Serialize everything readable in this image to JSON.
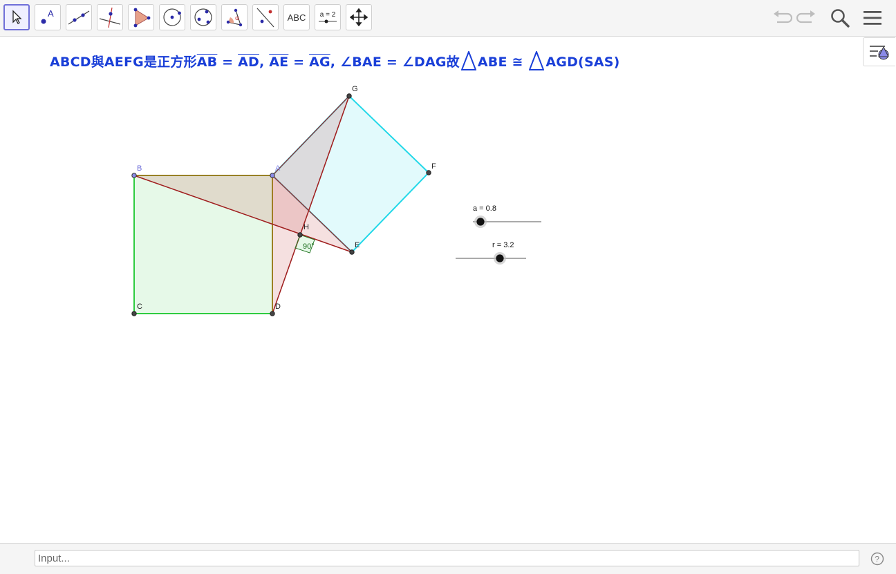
{
  "toolbar": {
    "tools": [
      {
        "name": "move-tool",
        "label": ""
      },
      {
        "name": "point-tool",
        "label": "A"
      },
      {
        "name": "line-tool",
        "label": ""
      },
      {
        "name": "perpendicular-line-tool",
        "label": ""
      },
      {
        "name": "polygon-tool",
        "label": ""
      },
      {
        "name": "circle-tool",
        "label": ""
      },
      {
        "name": "conic-tool",
        "label": ""
      },
      {
        "name": "angle-tool",
        "label": "α"
      },
      {
        "name": "reflect-tool",
        "label": ""
      },
      {
        "name": "text-tool",
        "label": "ABC"
      },
      {
        "name": "slider-tool",
        "label": "a = 2"
      },
      {
        "name": "move-graphics-view-tool",
        "label": ""
      }
    ]
  },
  "formula": {
    "intro": "ABCD與AEFG是正方形",
    "seg1": "AB",
    "eq1": " = ",
    "seg2": "AD",
    "comma1": ", ",
    "seg3": "AE",
    "eq2": " = ",
    "seg4": "AG",
    "angles": ", ∠BAE = ∠DAG故",
    "tri1": "ABE ≅ ",
    "tri2": "AGD(SAS)"
  },
  "points": {
    "A": "A",
    "B": "B",
    "C": "C",
    "D": "D",
    "E": "E",
    "F": "F",
    "G": "G",
    "H": "H"
  },
  "angle_label": "90°",
  "sliders": {
    "a": {
      "label": "a = 0.8",
      "value": 0.8
    },
    "r": {
      "label": "r = 3.2",
      "value": 3.2
    }
  },
  "input": {
    "placeholder": "Input..."
  },
  "colors": {
    "square_abcd": "#2ecc40",
    "square_aefg": "#22d8e8",
    "triangle_edges": "#a02020",
    "formula": "#1a3fd8",
    "free_point": "#5b5bd6"
  }
}
